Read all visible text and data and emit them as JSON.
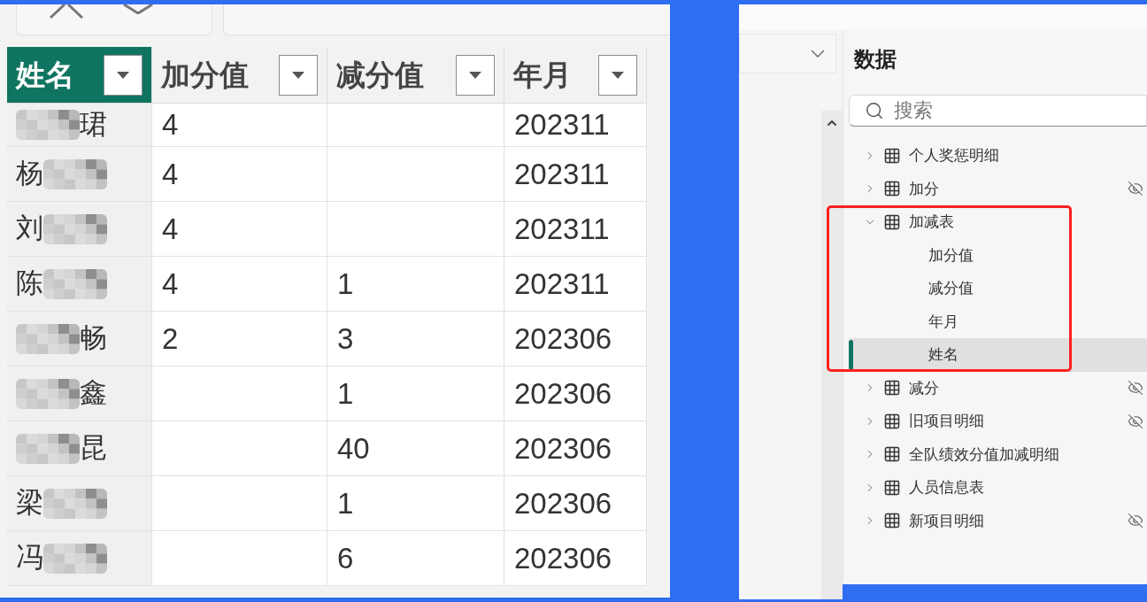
{
  "table": {
    "columns": [
      {
        "label": "姓名",
        "selected": true
      },
      {
        "label": "加分值",
        "selected": false
      },
      {
        "label": "减分值",
        "selected": false
      },
      {
        "label": "年月",
        "selected": false
      }
    ],
    "rows": [
      {
        "name": "珺",
        "blur_before": true,
        "blur_after": false,
        "bonus": "4",
        "year_month": "202311"
      },
      {
        "name": "杨",
        "blur_before": false,
        "blur_after": true,
        "bonus": "4",
        "year_month": "202311"
      },
      {
        "name": "刘",
        "blur_before": false,
        "blur_after": true,
        "bonus": "4",
        "year_month": "202311"
      },
      {
        "name": "陈",
        "blur_before": false,
        "blur_after": true,
        "bonus": "4",
        "deduction": "1",
        "year_month": "202311"
      },
      {
        "name": "畅",
        "blur_before": true,
        "blur_after": false,
        "bonus": "2",
        "deduction": "3",
        "year_month": "202306"
      },
      {
        "name": "鑫",
        "blur_before": true,
        "blur_after": false,
        "deduction": "1",
        "year_month": "202306"
      },
      {
        "name": "昆",
        "blur_before": true,
        "blur_after": false,
        "deduction": "40",
        "year_month": "202306"
      },
      {
        "name": "梁",
        "blur_before": false,
        "blur_after": true,
        "deduction": "1",
        "year_month": "202306"
      },
      {
        "name": "冯",
        "blur_before": false,
        "blur_after": true,
        "deduction": "6",
        "year_month": "202306"
      }
    ]
  },
  "data_pane": {
    "title": "数据",
    "search": {
      "placeholder": "搜索"
    },
    "tables": [
      {
        "label": "个人奖惩明细",
        "expanded": false,
        "hidden": false,
        "highlighted": false,
        "selected": false
      },
      {
        "label": "加分",
        "expanded": false,
        "hidden": true,
        "highlighted": false,
        "selected": false
      },
      {
        "label": "加减表",
        "expanded": true,
        "hidden": false,
        "highlighted": true,
        "selected": false,
        "children": [
          {
            "label": "加分值",
            "selected": false
          },
          {
            "label": "减分值",
            "selected": false
          },
          {
            "label": "年月",
            "selected": false
          },
          {
            "label": "姓名",
            "selected": true
          }
        ]
      },
      {
        "label": "减分",
        "expanded": false,
        "hidden": true,
        "highlighted": false,
        "selected": false
      },
      {
        "label": "旧项目明细",
        "expanded": false,
        "hidden": true,
        "highlighted": false,
        "selected": false
      },
      {
        "label": "全队绩效分值加减明细",
        "expanded": false,
        "hidden": false,
        "highlighted": false,
        "selected": false
      },
      {
        "label": "人员信息表",
        "expanded": false,
        "hidden": false,
        "highlighted": false,
        "selected": false
      },
      {
        "label": "新项目明细",
        "expanded": false,
        "hidden": true,
        "highlighted": false,
        "selected": false
      }
    ]
  }
}
